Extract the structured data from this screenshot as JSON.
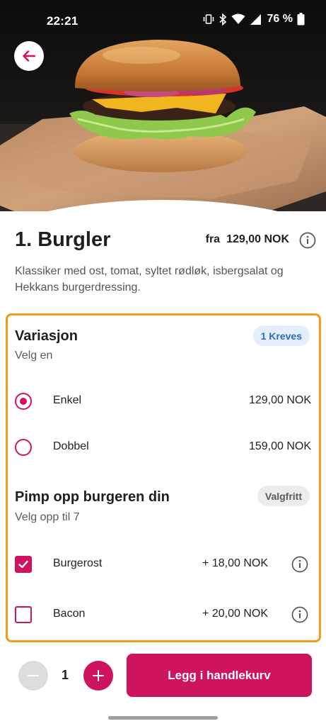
{
  "status_bar": {
    "time": "22:21",
    "battery_text": "76 %",
    "icons": [
      "vibrate-icon",
      "bluetooth-icon",
      "wifi-icon",
      "cellular-signal-icon",
      "battery-icon"
    ]
  },
  "hero": {
    "image": "burger-photo",
    "back_icon": "arrow-left-icon"
  },
  "product": {
    "title": "1. Burgler",
    "price_prefix": "fra",
    "price": "129,00 NOK",
    "description": "Klassiker med ost, tomat, syltet rødløk, isbergsalat og Hekkans burgerdressing."
  },
  "groups": [
    {
      "title": "Variasjon",
      "subtitle": "Velg en",
      "badge": "1 Kreves",
      "options": [
        {
          "label": "Enkel",
          "price": "129,00 NOK",
          "selected": true
        },
        {
          "label": "Dobbel",
          "price": "159,00 NOK",
          "selected": false
        }
      ]
    },
    {
      "title": "Pimp opp burgeren din",
      "subtitle": "Velg opp til 7",
      "badge": "Valgfritt",
      "options": [
        {
          "label": "Burgerost",
          "price": "+ 18,00 NOK",
          "selected": true
        },
        {
          "label": "Bacon",
          "price": "+ 20,00 NOK",
          "selected": false
        }
      ]
    }
  ],
  "cart": {
    "quantity": "1",
    "add_button_label": "Legg i handlekurv"
  },
  "colors": {
    "accent": "#cf145f",
    "panel_border": "#f29b1d",
    "badge_required_bg": "#e3eefc",
    "badge_required_text": "#2f6bbd"
  }
}
